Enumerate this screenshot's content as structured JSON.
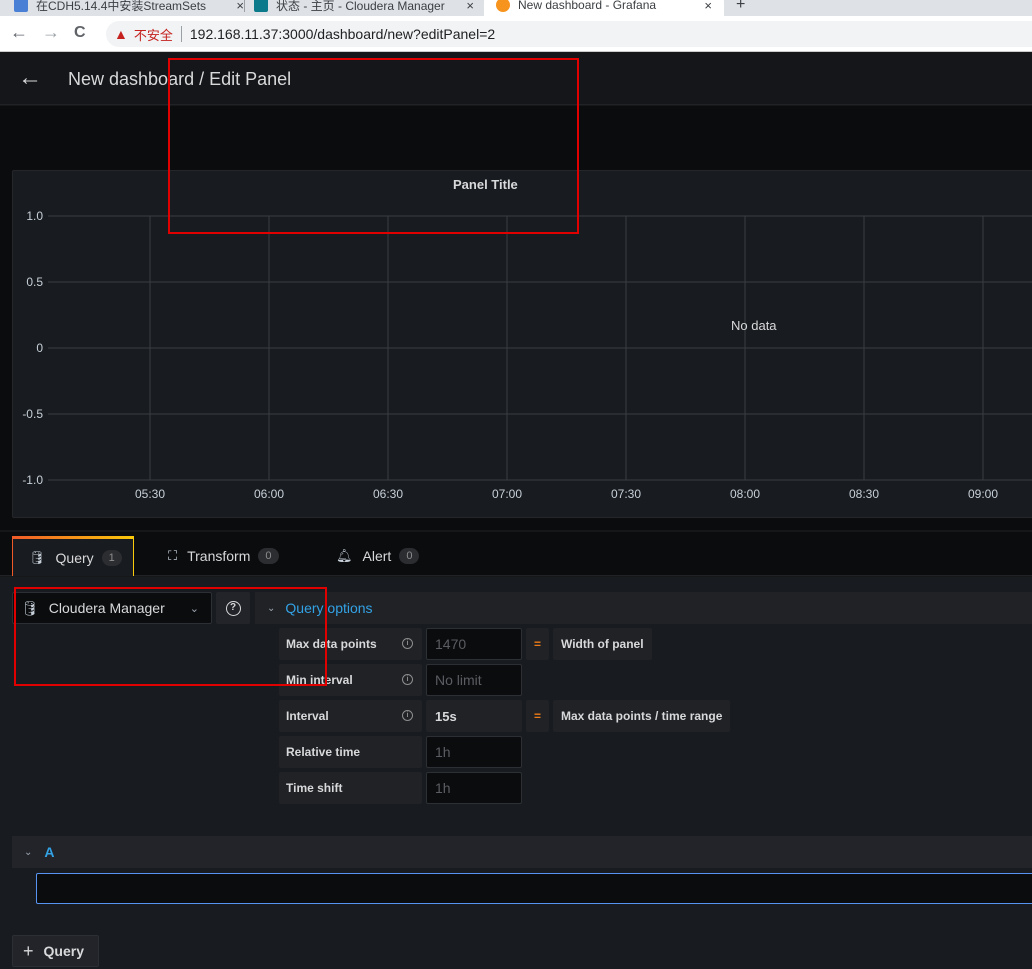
{
  "browser": {
    "tabs": [
      {
        "title": "在CDH5.14.4中安装StreamSets",
        "favicon_color": "#4a7fd6"
      },
      {
        "title": "状态 - 主页 - Cloudera Manager",
        "favicon_color": "#0b7a8a"
      },
      {
        "title": "New dashboard - Grafana",
        "favicon_color": "#f7941d",
        "active": true
      }
    ],
    "new_tab_icon": "+",
    "close_icon": "×",
    "nav": {
      "back": "←",
      "forward": "→",
      "reload": "C"
    },
    "security_warning": "不安全",
    "url": "192.168.11.37:3000/dashboard/new?editPanel=2"
  },
  "header": {
    "back_icon": "←",
    "title": "New dashboard / Edit Panel"
  },
  "panel": {
    "title": "Panel Title",
    "no_data": "No data"
  },
  "chart_data": {
    "type": "line",
    "title": "Panel Title",
    "xlabel": "",
    "ylabel": "",
    "series": [],
    "y_ticks": [
      "1.0",
      "0.5",
      "0",
      "-0.5",
      "-1.0"
    ],
    "ylim": [
      -1.0,
      1.0
    ],
    "x_ticks": [
      "05:30",
      "06:00",
      "06:30",
      "07:00",
      "07:30",
      "08:00",
      "08:30",
      "09:00"
    ],
    "grid": true,
    "annotation": "No data"
  },
  "editor_tabs": [
    {
      "label": "Query",
      "count": "1",
      "icon": "database-icon",
      "active": true
    },
    {
      "label": "Transform",
      "count": "0",
      "icon": "transform-icon"
    },
    {
      "label": "Alert",
      "count": "0",
      "icon": "bell-icon"
    }
  ],
  "datasource": {
    "name": "Cloudera Manager",
    "help_icon": "?"
  },
  "query_options": {
    "label": "Query options",
    "rows": [
      {
        "label": "Max data points",
        "info": true,
        "value": "1470",
        "is_placeholder": true,
        "eq": "=",
        "desc": "Width of panel"
      },
      {
        "label": "Min interval",
        "info": true,
        "value": "No limit",
        "is_placeholder": true
      },
      {
        "label": "Interval",
        "info": true,
        "value": "15s",
        "is_placeholder": false,
        "eq": "=",
        "desc": "Max data points / time range"
      },
      {
        "label": "Relative time",
        "info": false,
        "value": "1h",
        "is_placeholder": true
      },
      {
        "label": "Time shift",
        "info": false,
        "value": "1h",
        "is_placeholder": true
      }
    ]
  },
  "query_row": {
    "ref_id": "A",
    "query_text": ""
  },
  "add_query_label": "Query",
  "add_query_icon": "+",
  "colors": {
    "accent_blue": "#33a2e5",
    "focus_border": "#5794f2",
    "eq_orange": "#eb7b18",
    "annotation_red": "#e00000"
  }
}
